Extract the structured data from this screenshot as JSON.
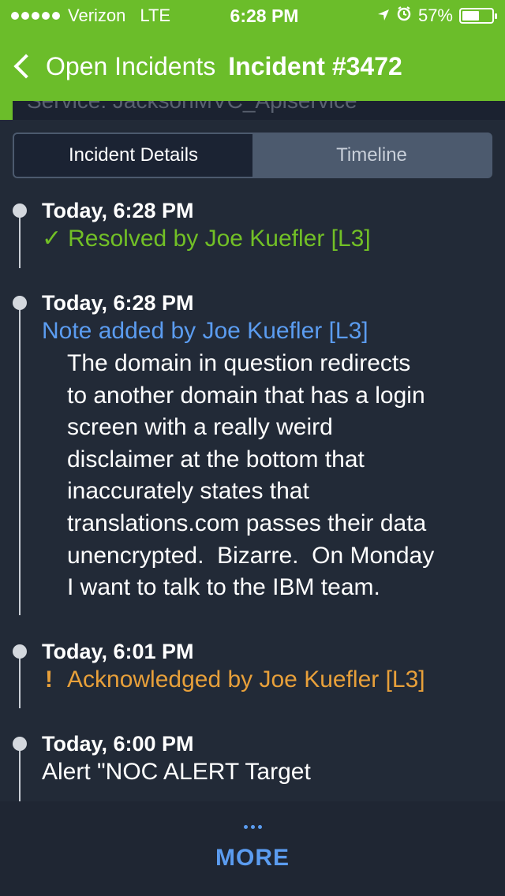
{
  "status_bar": {
    "carrier": "Verizon",
    "network": "LTE",
    "time": "6:28 PM",
    "battery_percent": "57%",
    "battery_level": 0.57,
    "icons": [
      "signal-dots-icon",
      "location-arrow-icon",
      "alarm-icon",
      "battery-icon"
    ]
  },
  "nav": {
    "back_label": "Open Incidents",
    "title": "Incident #3472",
    "back_icon": "chevron-left-icon"
  },
  "peek_text": "Service: JacksonMVC_Apiservice",
  "tabs": [
    {
      "label": "Incident Details",
      "active": true
    },
    {
      "label": "Timeline",
      "active": false
    }
  ],
  "timeline": [
    {
      "time": "Today, 6:28 PM",
      "icon": "check-icon",
      "icon_glyph": "✓",
      "event": "Resolved by Joe Kuefler [L3]",
      "color": "#72c026"
    },
    {
      "time": "Today, 6:28 PM",
      "event": "Note added by Joe Kuefler [L3]",
      "color": "#5b9cf0",
      "body": "The domain in question redirects\nto another domain that has a login\nscreen with a really weird\ndisclaimer at the bottom that\ninaccurately states that\ntranslations.com passes their data\nunencrypted.  Bizarre.  On Monday\nI want to talk to the IBM team."
    },
    {
      "time": "Today, 6:01 PM",
      "icon": "exclamation-icon",
      "icon_glyph": "!",
      "event": "Acknowledged by Joe Kuefler [L3]",
      "color": "#e8a03a"
    },
    {
      "time": "Today, 6:00 PM",
      "event": "Alert \"NOC ALERT Target",
      "color": "#ffffff"
    }
  ],
  "bottom": {
    "dots_icon": "ellipsis-icon",
    "more_label": "MORE"
  },
  "colors": {
    "brand_green": "#6bbd2a",
    "background": "#222a37",
    "link_blue": "#5b9cf0",
    "warning_orange": "#e8a03a"
  }
}
